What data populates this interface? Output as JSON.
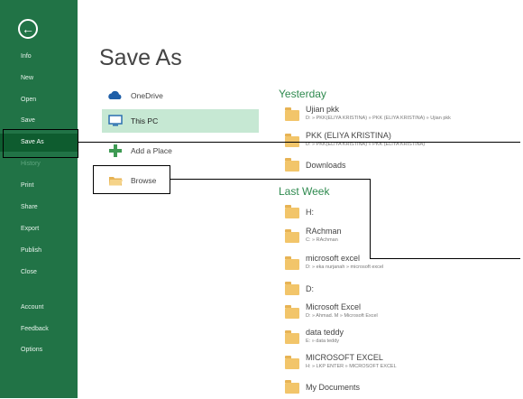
{
  "sidebar": {
    "back_icon": "arrow-left-circle-icon",
    "items": [
      {
        "label": "Info"
      },
      {
        "label": "New"
      },
      {
        "label": "Open"
      },
      {
        "label": "Save"
      },
      {
        "label": "Save As",
        "active": true
      },
      {
        "label": "History",
        "disabled": true
      },
      {
        "label": "Print"
      },
      {
        "label": "Share"
      },
      {
        "label": "Export"
      },
      {
        "label": "Publish"
      },
      {
        "label": "Close"
      },
      {
        "label": "Account"
      },
      {
        "label": "Feedback"
      },
      {
        "label": "Options"
      }
    ]
  },
  "main": {
    "title": "Save As",
    "locations": [
      {
        "label": "OneDrive",
        "icon": "cloud-icon"
      },
      {
        "label": "This PC",
        "icon": "computer-icon",
        "selected": true
      },
      {
        "label": "Add a Place",
        "icon": "plus-icon"
      },
      {
        "label": "Browse",
        "icon": "folder-open-icon"
      }
    ]
  },
  "recent": {
    "yesterday_label": "Yesterday",
    "yesterday": [
      {
        "name": "Ujian pkk",
        "path": "D: » PKK(ELIYA KRISTINA) » PKK (ELIYA KRISTINA) » Ujian pkk"
      },
      {
        "name": "PKK (ELIYA KRISTINA)",
        "path": "D: » PKK(ELIYA KRISTINA) » PKK (ELIYA KRISTINA)"
      },
      {
        "name": "Downloads",
        "path": ""
      }
    ],
    "last_week_label": "Last Week",
    "last_week": [
      {
        "name": "H:",
        "path": ""
      },
      {
        "name": "RAchman",
        "path": "C: » RAchman"
      },
      {
        "name": "microsoft excel",
        "path": "D: » eka nurjanah » microsoft excel"
      },
      {
        "name": "D:",
        "path": ""
      },
      {
        "name": "Microsoft Excel",
        "path": "D: » Ahmad. M » Microsoft Excel"
      },
      {
        "name": "data teddy",
        "path": "E: » data teddy"
      },
      {
        "name": "MICROSOFT EXCEL",
        "path": "H: » LKP ENTER » MICROSOFT EXCEL"
      },
      {
        "name": "My Documents",
        "path": ""
      }
    ]
  },
  "colors": {
    "sidebar": "#217346",
    "accent": "#2f8a4f",
    "selected": "#c6e8d3",
    "folder": "#f2c56a"
  }
}
